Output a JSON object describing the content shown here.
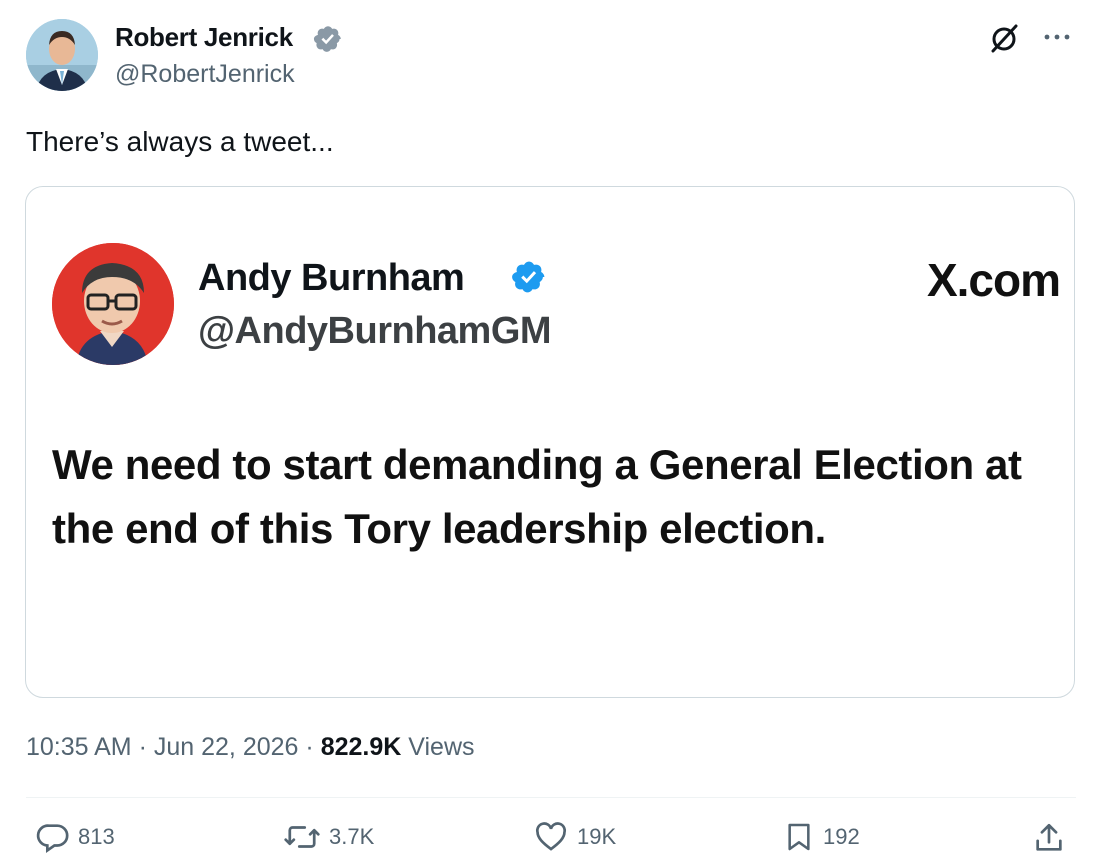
{
  "author": {
    "name": "Robert Jenrick",
    "handle": "@RobertJenrick",
    "verified": true
  },
  "tweet_text": "There’s always a tweet...",
  "quoted": {
    "name": "Andy Burnham",
    "handle": "@AndyBurnhamGM",
    "verified": true,
    "brand": "X.com",
    "text": "We need to start demanding a General Election at the end of this Tory leadership election."
  },
  "meta": {
    "time": "10:35 AM",
    "date": "Jun 22, 2026",
    "views_count": "822.9K",
    "views_label": "Views"
  },
  "actions": {
    "replies": "813",
    "reposts": "3.7K",
    "likes": "19K",
    "bookmarks": "192"
  },
  "colors": {
    "verified": "#1d9bf0",
    "secondary_text": "#536471",
    "avatar_red": "#e0352c"
  },
  "icons": [
    "grok-icon",
    "more-icon",
    "reply-icon",
    "repost-icon",
    "like-icon",
    "bookmark-icon",
    "share-icon",
    "verified-badge-icon"
  ]
}
